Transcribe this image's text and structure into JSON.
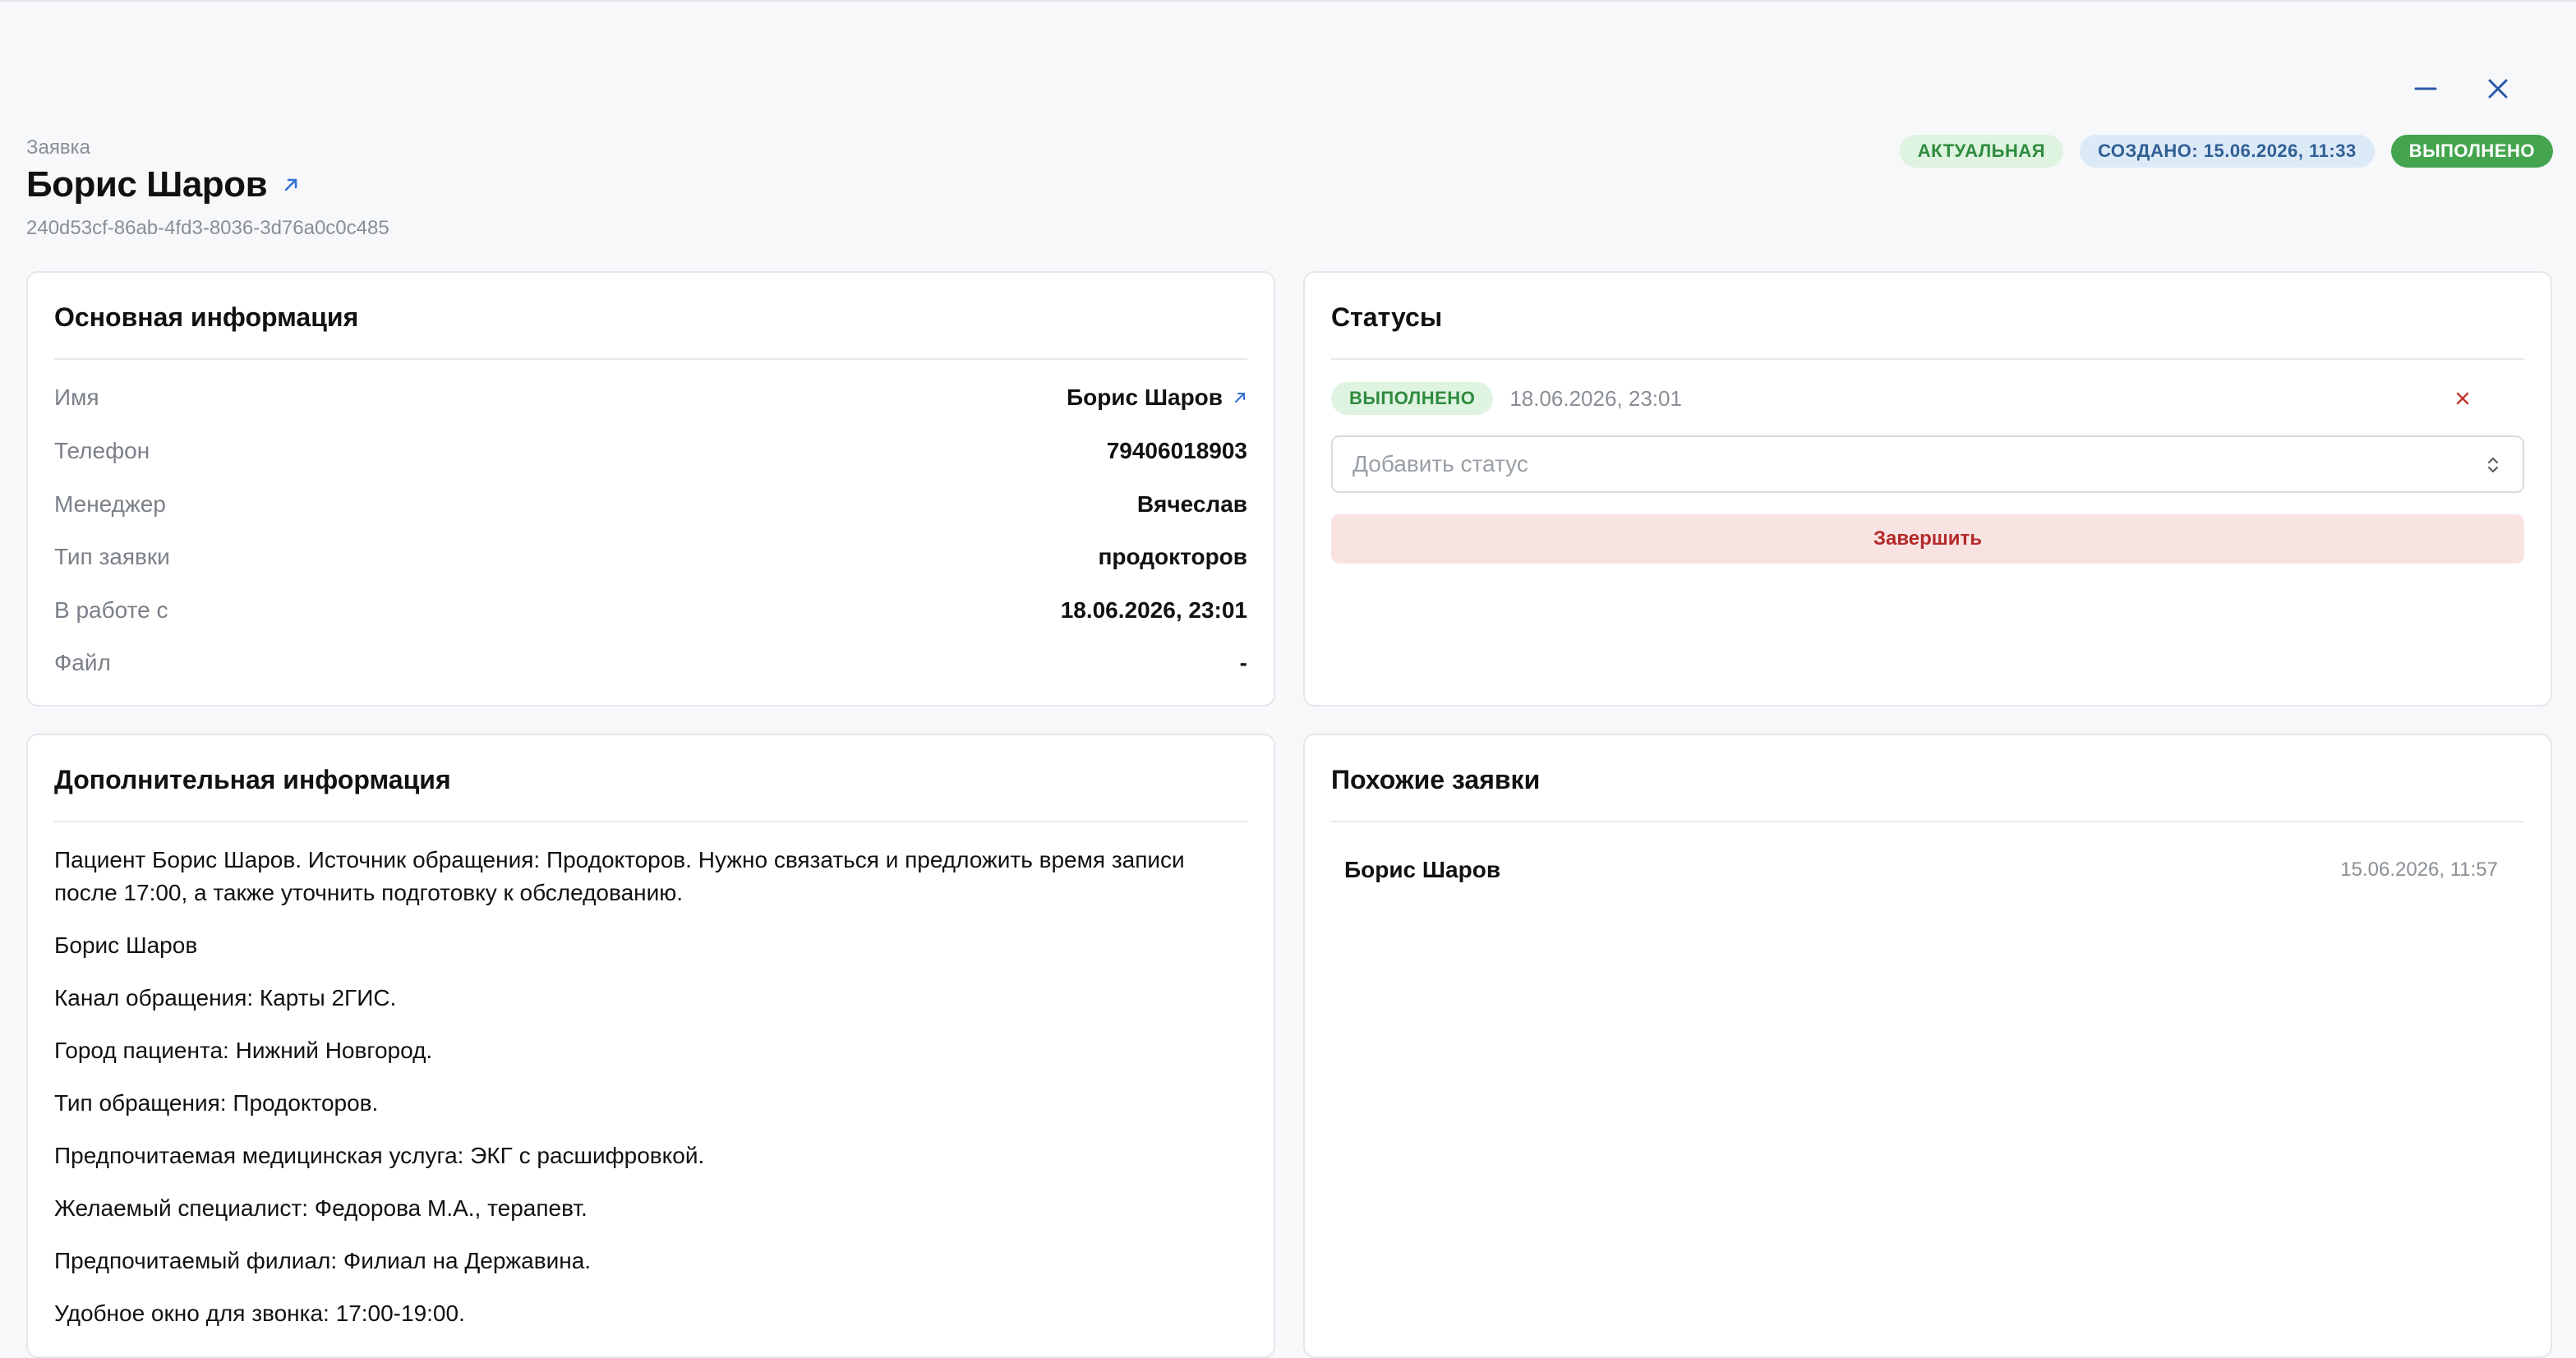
{
  "header": {
    "breadcrumb": "Заявка",
    "title": "Борис Шаров",
    "uuid": "240d53cf-86ab-4fd3-8036-3d76a0c0c485",
    "badges": [
      {
        "label": "АКТУАЛЬНАЯ",
        "color": "#dff3e1"
      },
      {
        "label": "СОЗДАНО: 15.06.2026, 11:33",
        "color": "#dce9f7"
      },
      {
        "label": "ВЫПОЛНЕНО",
        "color": "#45a54f"
      }
    ]
  },
  "window": {
    "minimize_icon": "minimize-icon",
    "close_icon": "close-icon"
  },
  "main_info": {
    "title": "Основная информация",
    "rows": [
      {
        "label": "Имя",
        "value": "Борис Шаров",
        "has_link": true
      },
      {
        "label": "Телефон",
        "value": "79406018903"
      },
      {
        "label": "Менеджер",
        "value": "Вячеслав"
      },
      {
        "label": "Тип заявки",
        "value": "продокторов"
      },
      {
        "label": "В работе с",
        "value": "18.06.2026, 23:01"
      },
      {
        "label": "Файл",
        "value": "-"
      }
    ]
  },
  "statuses": {
    "title": "Статусы",
    "items": [
      {
        "label": "ВЫПОЛНЕНО",
        "time": "18.06.2026, 23:01"
      }
    ],
    "add_placeholder": "Добавить статус",
    "finish_label": "Завершить"
  },
  "additional_info": {
    "title": "Дополнительная информация",
    "paragraphs": [
      "Пациент Борис Шаров. Источник обращения: Продокторов. Нужно связаться и предложить время записи после 17:00, а также уточнить подготовку к обследованию.",
      "Борис Шаров",
      "Канал обращения: Карты 2ГИС.",
      "Город пациента: Нижний Новгород.",
      "Тип обращения: Продокторов.",
      "Предпочитаемая медицинская услуга: ЭКГ с расшифровкой.",
      "Желаемый специалист: Федорова М.А., терапевт.",
      "Предпочитаемый филиал: Филиал на Державина.",
      "Удобное окно для звонка: 17:00-19:00."
    ]
  },
  "similar": {
    "title": "Похожие заявки",
    "items": [
      {
        "name": "Борис Шаров",
        "date": "15.06.2026, 11:57"
      }
    ]
  },
  "colors": {
    "accent_blue": "#2f6fd6",
    "danger": "#c0392b",
    "success": "#45a54f"
  }
}
